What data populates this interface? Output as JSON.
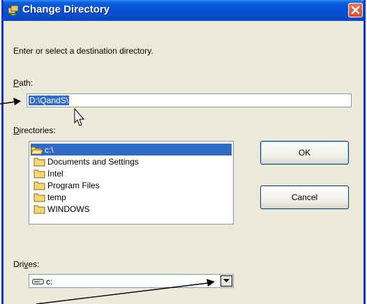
{
  "window": {
    "title": "Change Directory"
  },
  "dialog": {
    "instruction": "Enter or select a destination directory.",
    "path": {
      "label_prefix": "",
      "label_mnemonic": "P",
      "label_rest": "ath:",
      "value_selected": "D:\\QandS\\"
    },
    "directories": {
      "label_mnemonic": "D",
      "label_rest": "irectories:",
      "items": [
        {
          "label": "c:\\",
          "selected": true,
          "open": true
        },
        {
          "label": "Documents and Settings"
        },
        {
          "label": "Intel"
        },
        {
          "label": "Program Files"
        },
        {
          "label": "temp"
        },
        {
          "label": "WINDOWS"
        }
      ]
    },
    "buttons": {
      "ok": "OK",
      "cancel": "Cancel"
    },
    "drives": {
      "label_prefix": "Dri",
      "label_mnemonic": "v",
      "label_rest": "es:",
      "value": "c:"
    }
  },
  "colors": {
    "titlebar": "#0a4fd0",
    "selection": "#316ac5",
    "face": "#ece9d8"
  },
  "icons": [
    "window-icon",
    "close-icon",
    "folder-open-icon",
    "folder-icon",
    "drive-icon",
    "chevron-down-icon"
  ]
}
